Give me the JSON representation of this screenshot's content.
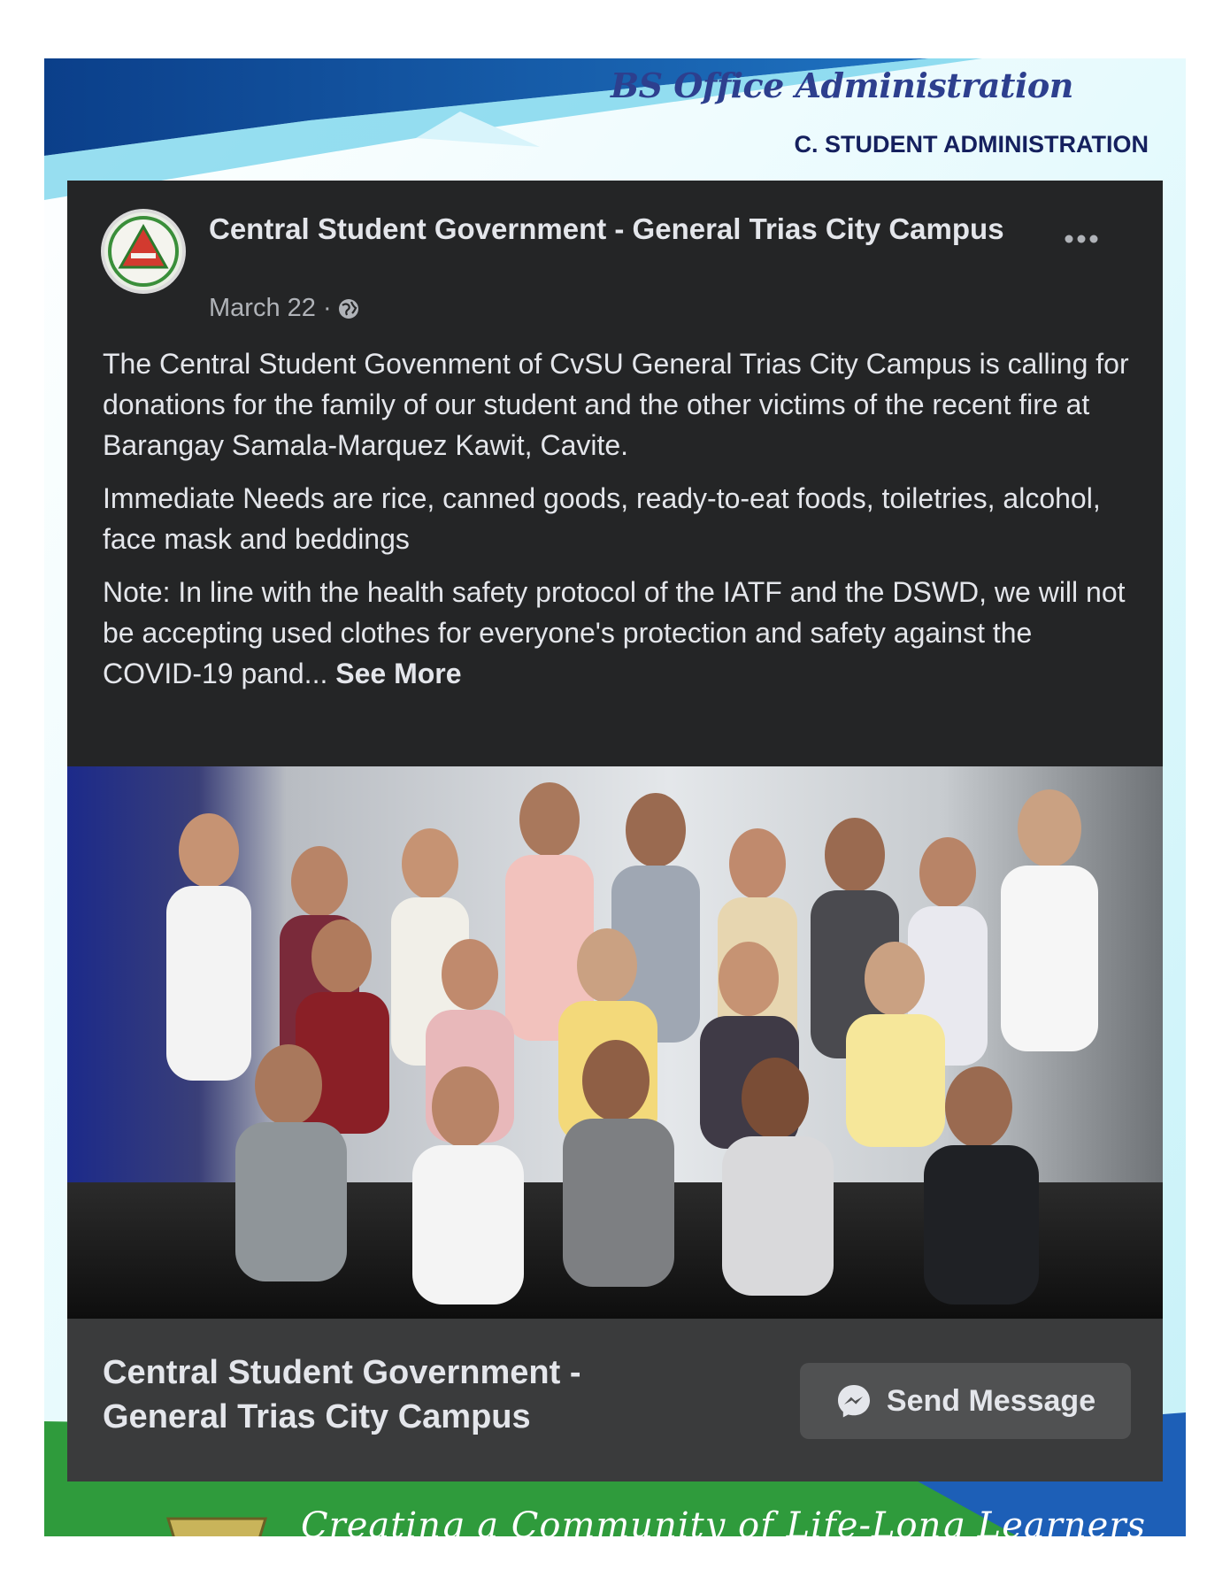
{
  "document": {
    "title": "BS Office Administration",
    "section": "C. STUDENT ADMINISTRATION",
    "tagline": "Creating a Community of Life-Long Learners"
  },
  "post": {
    "page_name": "Central Student Government - General Trias City Campus",
    "date": "March 22 ·",
    "privacy_icon": "globe-icon",
    "more_icon": "more-options-icon",
    "paragraphs": [
      "The Central Student Govenment of CvSU General Trias City Campus is calling for donations for the family of our student and the other victims of the recent fire at Barangay Samala-Marquez Kawit, Cavite.",
      "Immediate Needs are rice, canned goods, ready-to-eat foods, toiletries, alcohol, face mask and beddings",
      "Note: In line with the health safety protocol of the IATF and the DSWD, we will not be accepting used clothes for everyone's protection and safety against the COVID-19 pand..."
    ],
    "see_more": "See More"
  },
  "footer": {
    "page_name": "Central Student Government - General Trias City Campus",
    "send_message": "Send Message",
    "send_icon": "messenger-icon"
  },
  "colors": {
    "card": "#242526",
    "footer": "#3a3b3c",
    "text": "#e4e6eb",
    "muted": "#b0b3b8",
    "title_blue": "#2d3f8e",
    "section_navy": "#15205e"
  }
}
